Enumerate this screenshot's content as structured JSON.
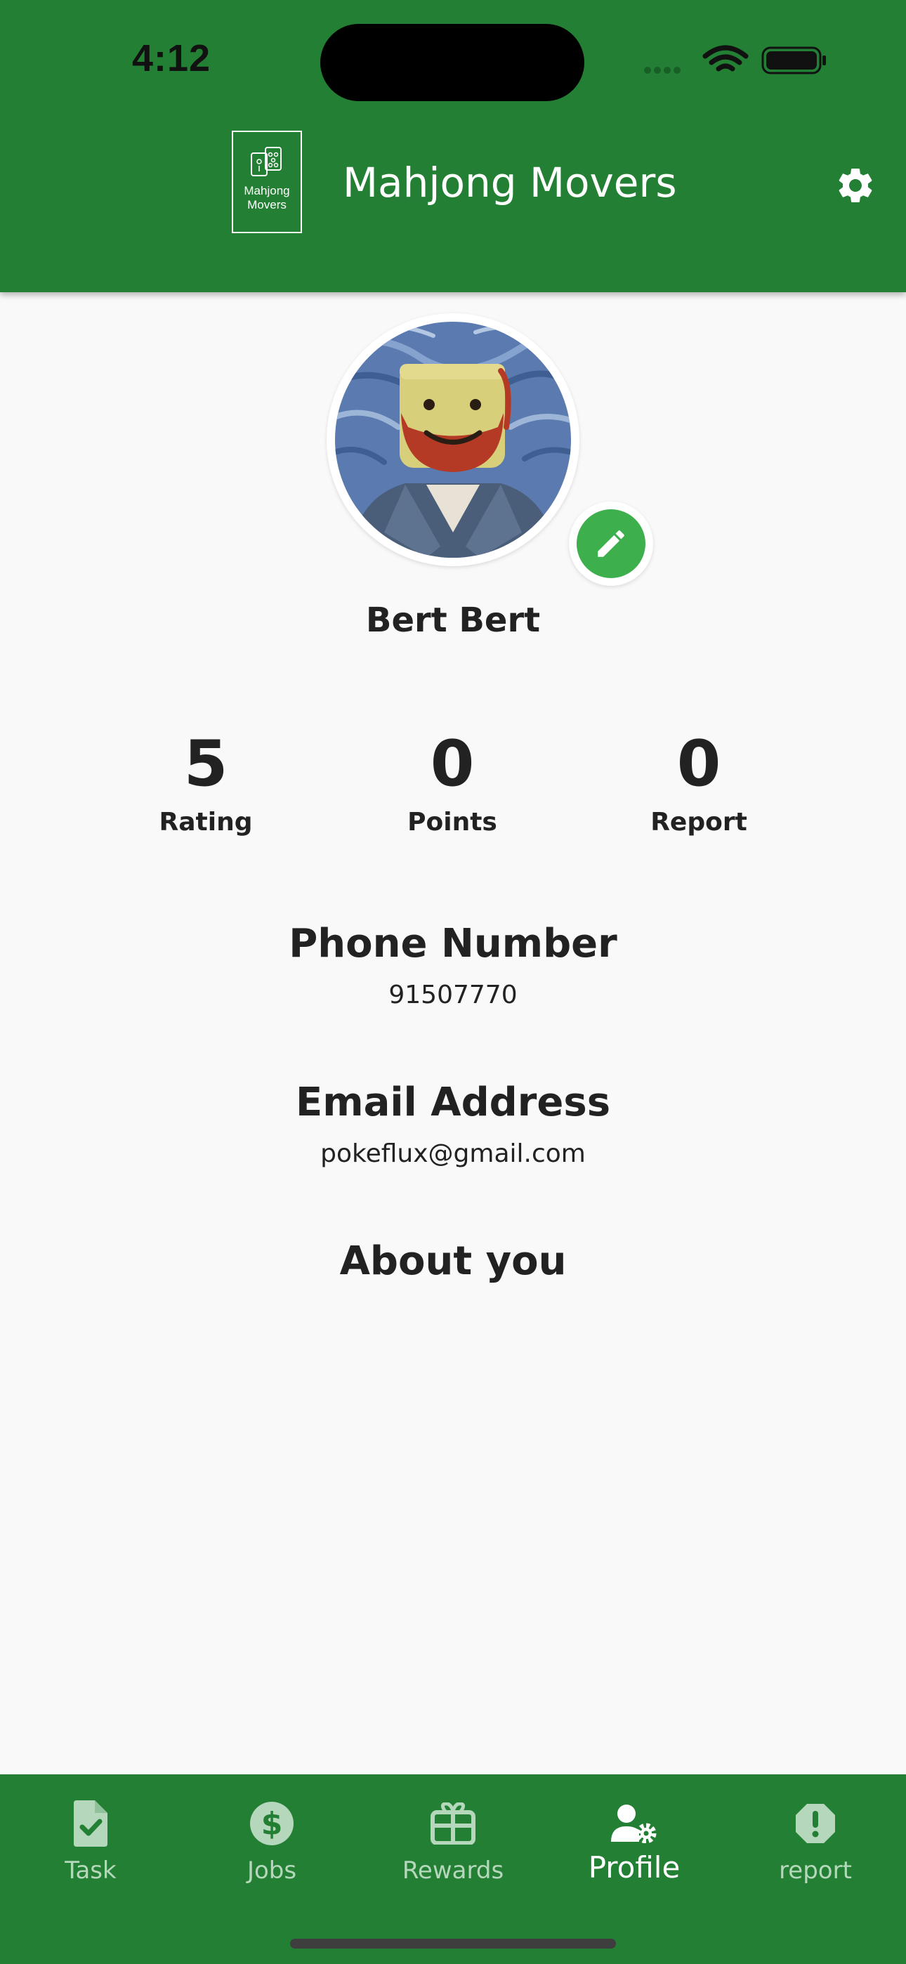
{
  "status_bar": {
    "time": "4:12"
  },
  "header": {
    "logo_text": "Mahjong Movers",
    "title": "Mahjong Movers",
    "settings_icon": "gear-icon"
  },
  "profile": {
    "name": "Bert Bert",
    "avatar": "profile-photo",
    "edit_icon": "pencil-icon"
  },
  "stats": [
    {
      "value": "5",
      "label": "Rating"
    },
    {
      "value": "0",
      "label": "Points"
    },
    {
      "value": "0",
      "label": "Report"
    }
  ],
  "phone": {
    "title": "Phone Number",
    "value": "91507770"
  },
  "email": {
    "title": "Email Address",
    "value": "pokeflux@gmail.com"
  },
  "about": {
    "title": "About you",
    "value": ""
  },
  "bottom_nav": {
    "active": "Profile",
    "items": [
      {
        "label": "Task",
        "icon": "task-check-icon"
      },
      {
        "label": "Jobs",
        "icon": "dollar-icon"
      },
      {
        "label": "Rewards",
        "icon": "gift-icon"
      },
      {
        "label": "Profile",
        "icon": "user-gear-icon"
      },
      {
        "label": "report",
        "icon": "alert-icon"
      }
    ]
  },
  "colors": {
    "primary": "#237F33",
    "accent": "#3DAF4D",
    "background": "#F9F9F9",
    "inactive_nav": "#B5D7BB"
  }
}
